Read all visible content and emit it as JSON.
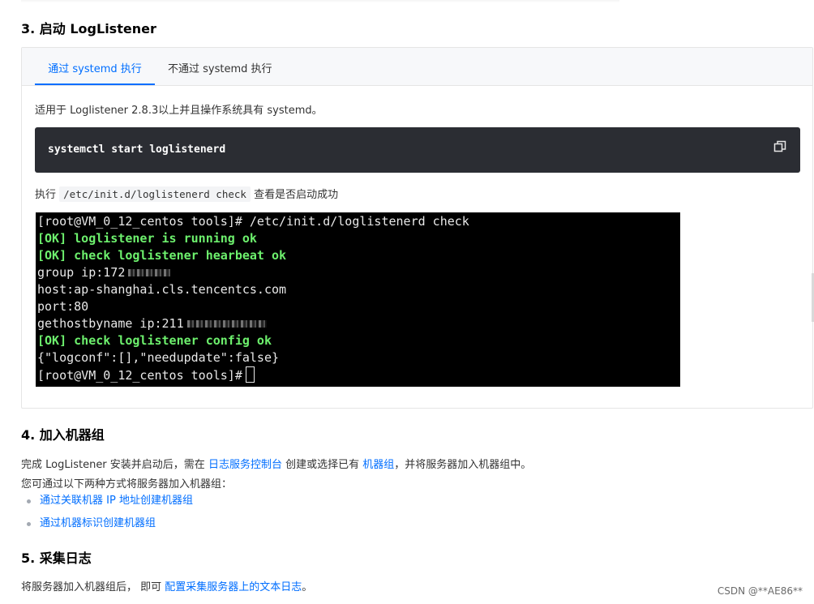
{
  "section3": {
    "heading": "3. 启动 LogListener",
    "tabs": [
      "通过 systemd 执行",
      "不通过 systemd 执行"
    ],
    "note": "适用于 Loglistener 2.8.3以上并且操作系统具有 systemd。",
    "command": "systemctl start loglistenerd",
    "check_prefix": "执行",
    "check_code": "/etc/init.d/loglistenerd check",
    "check_suffix": "查看是否启动成功",
    "terminal": {
      "line1": "[root@VM_0_12_centos tools]# /etc/init.d/loglistenerd check",
      "line2": "[OK] loglistener is running ok",
      "line3": "[OK] check loglistener hearbeat ok",
      "line4": "group ip:172",
      "line5": "host:ap-shanghai.cls.tencentcs.com",
      "line6": "port:80",
      "line7": "gethostbyname ip:211",
      "line8": "[OK] check loglistener config ok",
      "line9": "{\"logconf\":[],\"needupdate\":false}",
      "line10": "[root@VM_0_12_centos tools]#"
    }
  },
  "section4": {
    "heading": "4. 加入机器组",
    "p1_a": "完成 LogListener 安装并启动后，需在",
    "p1_link1": "日志服务控制台",
    "p1_b": "创建或选择已有",
    "p1_link2": "机器组",
    "p1_c": "，并将服务器加入机器组中。",
    "p2": "您可通过以下两种方式将服务器加入机器组：",
    "bullets": [
      "通过关联机器 IP 地址创建机器组",
      "通过机器标识创建机器组"
    ]
  },
  "section5": {
    "heading": "5. 采集日志",
    "p_a": "将服务器加入机器组后， 即可",
    "p_link": "配置采集服务器上的文本日志",
    "p_b": "。"
  },
  "watermark": "CSDN @**AE86**",
  "colors": {
    "accent": "#006eff",
    "code_bg": "#2b2d33",
    "terminal_ok": "#6df06d"
  },
  "icons": {
    "copy": "copy-icon"
  }
}
